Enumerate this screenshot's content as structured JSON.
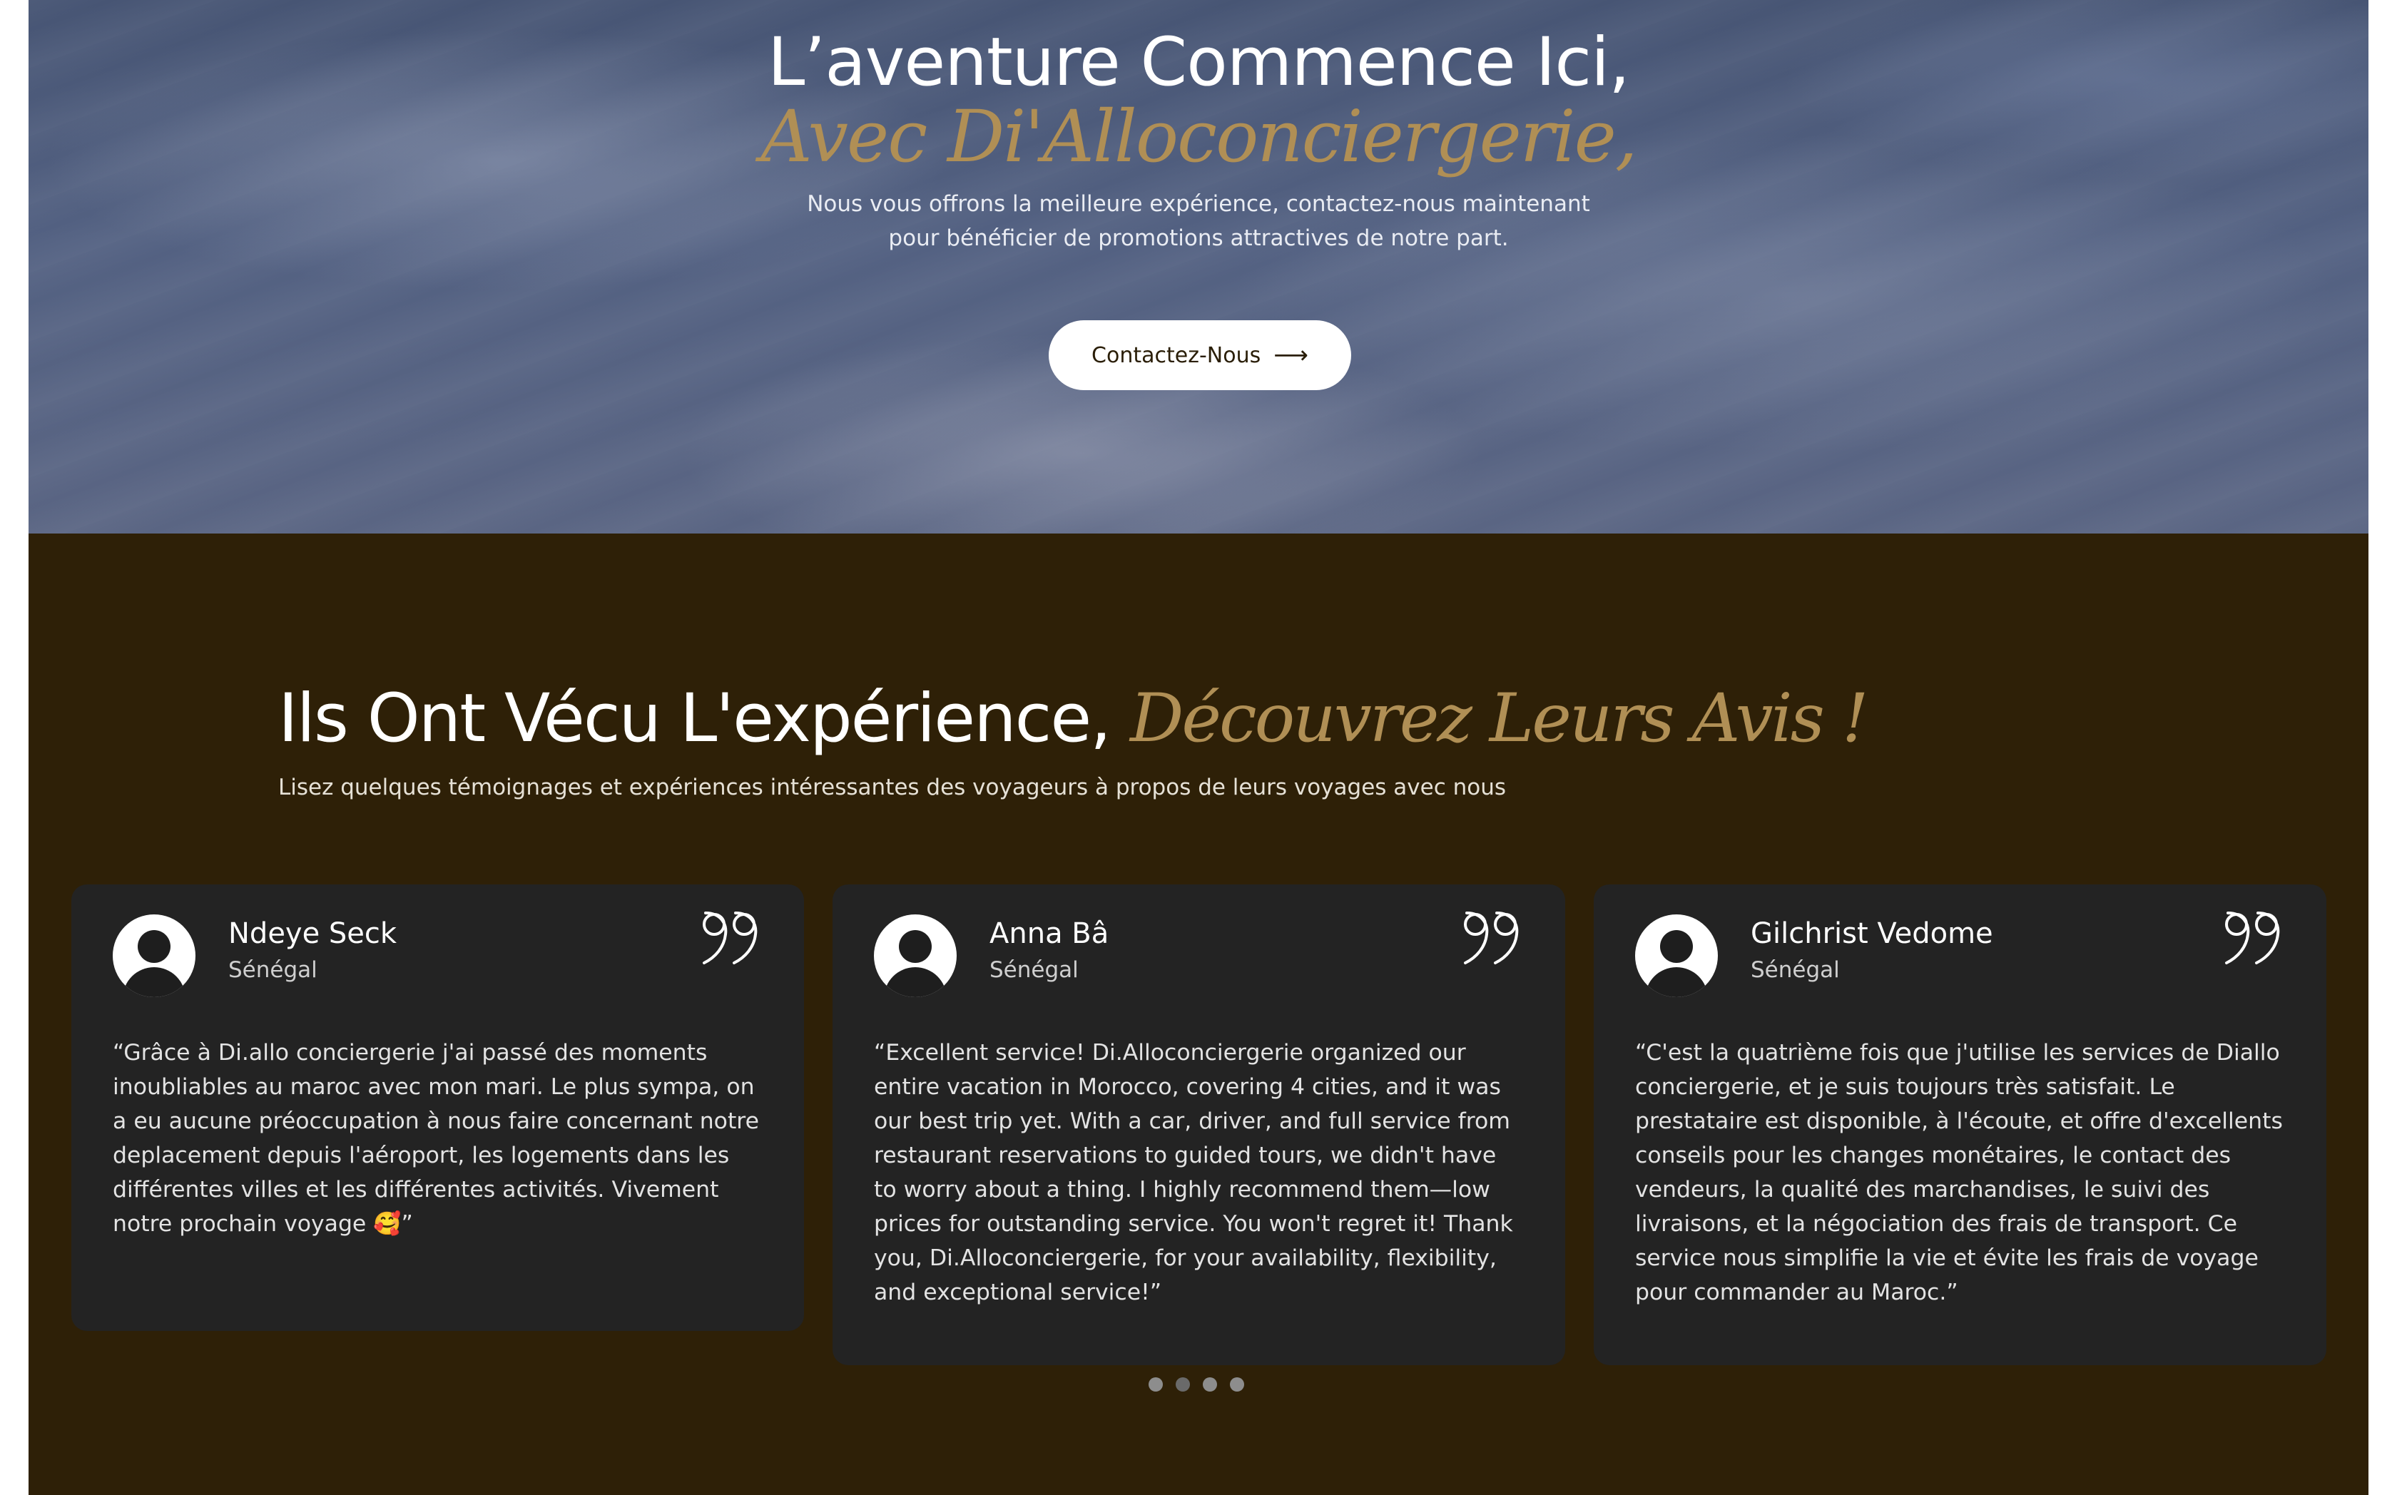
{
  "hero": {
    "title": "L’aventure Commence Ici,",
    "subtitle": "Avec Di'Alloconciergerie,",
    "text": "Nous vous offrons la meilleure expérience, contactez-nous maintenant pour bénéficier de promotions attractives de notre part.",
    "cta_label": "Contactez-Nous",
    "cta_icon": "arrow-right-icon"
  },
  "reviews": {
    "title_main": "Ils Ont Vécu L'expérience,",
    "title_accent": "Découvrez Leurs Avis !",
    "subtitle": "Lisez quelques témoignages et expériences intéressantes des voyageurs à propos de leurs voyages avec nous",
    "cards": [
      {
        "name": "Ndeye Seck",
        "country": "Sénégal",
        "text": "“Grâce à Di.allo conciergerie j'ai passé des moments inoubliables au maroc avec mon mari. Le plus sympa, on a eu aucune préoccupation à nous faire concernant notre deplacement depuis l'aéroport, les logements dans les différentes villes et les différentes activités. Vivement notre prochain voyage 🥰”"
      },
      {
        "name": "Anna Bâ",
        "country": "Sénégal",
        "text": "“Excellent service! Di.Alloconciergerie organized our entire vacation in Morocco, covering 4 cities, and it was our best trip yet. With a car, driver, and full service from restaurant reservations to guided tours, we didn't have to worry about a thing. I highly recommend them—low prices for outstanding service. You won't regret it! Thank you, Di.Alloconciergerie, for your availability, flexibility, and exceptional service!”"
      },
      {
        "name": "Gilchrist Vedome",
        "country": "Sénégal",
        "text": "“C'est la quatrième fois que j'utilise les services de Diallo conciergerie, et je suis toujours très satisfait. Le prestataire est disponible, à l'écoute, et offre d'excellents conseils pour les changes monétaires, le contact des vendeurs, la qualité des marchandises, le suivi des livraisons, et la négociation des frais de transport. Ce service nous simplifie la vie et évite les frais de voyage pour commander au Maroc.”"
      }
    ],
    "icons": {
      "avatar": "user-avatar-icon",
      "quote": "quote-icon"
    },
    "pagination": {
      "count": 4,
      "active_index": 1
    }
  },
  "colors": {
    "accent_gold": "#b08f55",
    "reviews_bg": "#2e2007",
    "card_bg": "#232323",
    "hero_sky": "#536182"
  }
}
